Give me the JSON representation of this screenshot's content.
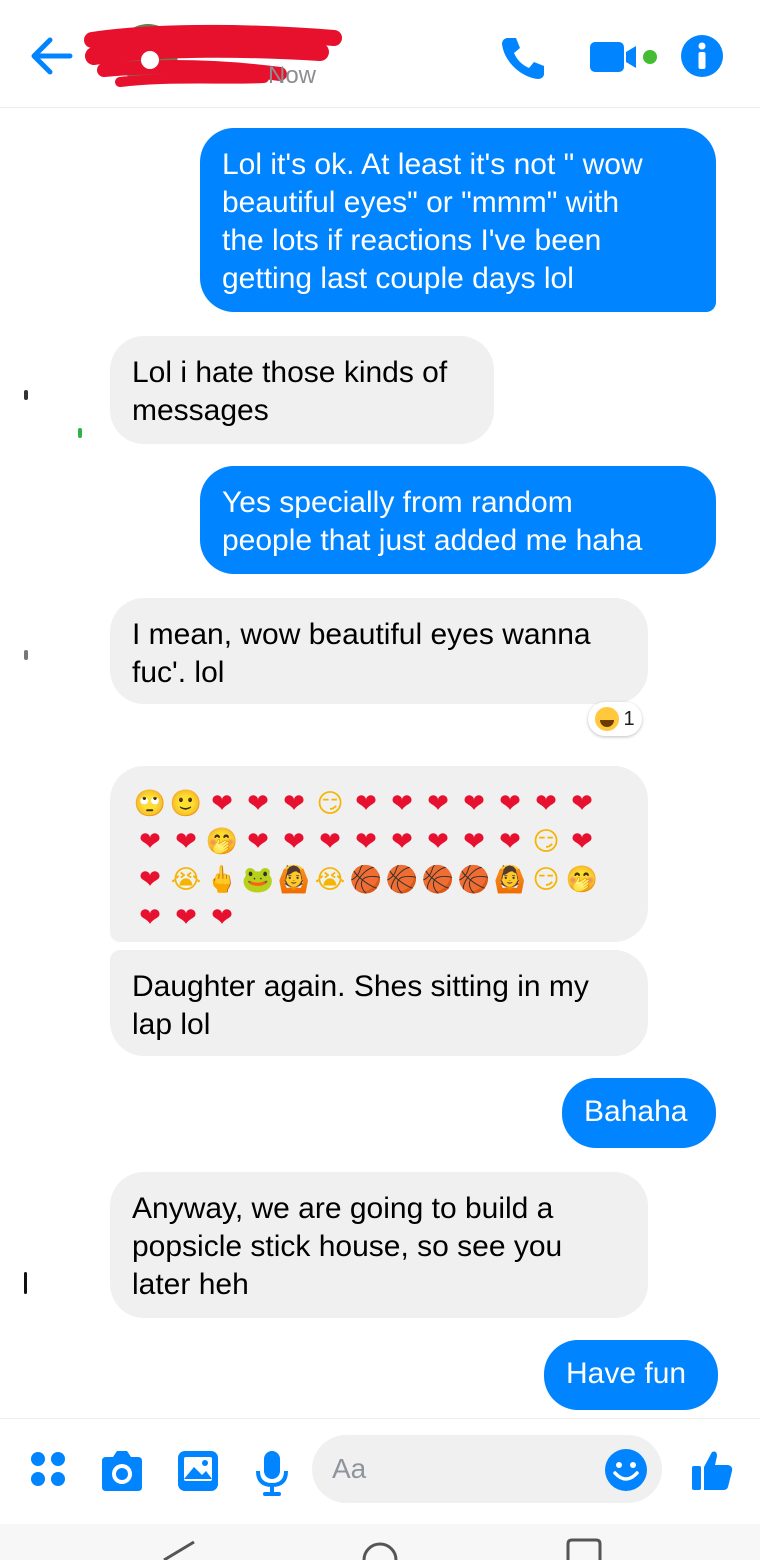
{
  "header": {
    "status": "Now",
    "colors": {
      "accent": "#0084ff",
      "redaction": "#e8112d"
    },
    "icons": [
      "back-arrow-icon",
      "phone-icon",
      "video-camera-icon",
      "info-icon"
    ]
  },
  "messages": [
    {
      "direction": "outgoing",
      "text": "Lol it's ok. At least it's not \" wow\nbeautiful eyes\" or \"mmm\" with\nthe lots if reactions I've been\ngetting last couple days lol"
    },
    {
      "direction": "incoming",
      "text": "Lol i hate those kinds of\nmessages"
    },
    {
      "direction": "outgoing",
      "text": "Yes specially from random\npeople that just added me haha"
    },
    {
      "direction": "incoming",
      "text": "I mean, wow beautiful eyes wanna\nfuc'. lol",
      "reaction": {
        "emoji": "grinning-squinting-face",
        "count": "1"
      }
    },
    {
      "direction": "incoming",
      "emojis": [
        "🙄",
        "🙂",
        "❤",
        "❤",
        "❤",
        "😏",
        "❤",
        "❤",
        "❤",
        "❤",
        "❤",
        "❤",
        "❤",
        "❤",
        "❤",
        "🤭",
        "❤",
        "❤",
        "❤",
        "❤",
        "❤",
        "❤",
        "❤",
        "❤",
        "😏",
        "❤",
        "❤",
        "😭",
        "🖕",
        "🐸",
        "🙆",
        "😭",
        "🏀",
        "🏀",
        "🏀",
        "🏀",
        "🙆",
        "😏",
        "🤭",
        "❤",
        "❤",
        "❤"
      ]
    },
    {
      "direction": "incoming",
      "text": "Daughter again. Shes sitting in my\nlap lol"
    },
    {
      "direction": "outgoing",
      "text": "Bahaha"
    },
    {
      "direction": "incoming",
      "text": "Anyway, we are going to build a\npopsicle stick house, so see you\nlater heh"
    },
    {
      "direction": "outgoing",
      "text": "Have fun"
    }
  ],
  "composer": {
    "placeholder": "Aa",
    "icons": [
      "apps-icon",
      "camera-icon",
      "image-icon",
      "microphone-icon",
      "emoji-icon",
      "thumbs-up-icon"
    ]
  },
  "navbar": {
    "icons": [
      "nav-back-icon",
      "nav-home-icon",
      "nav-recents-icon"
    ]
  }
}
